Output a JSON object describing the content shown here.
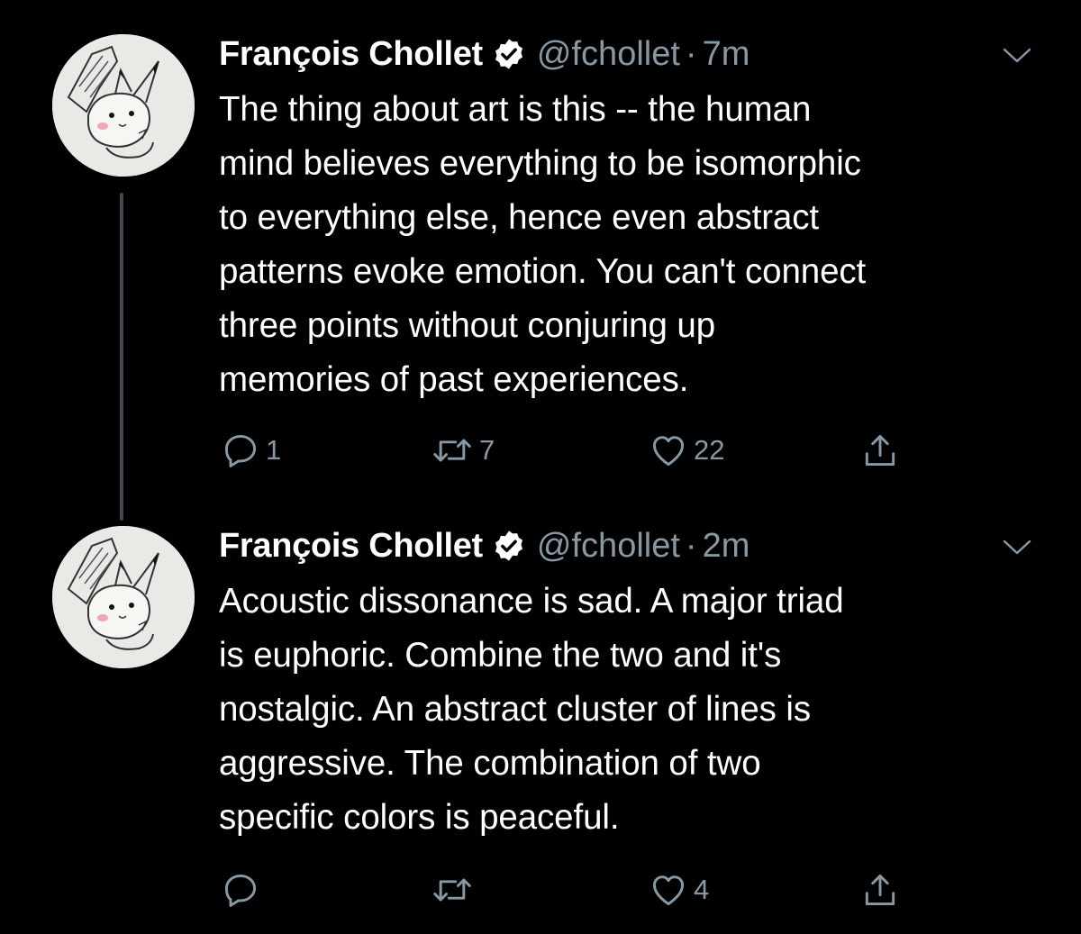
{
  "colors": {
    "background": "#000000",
    "text": "#ffffff",
    "secondary": "#8899a6",
    "thread_line": "#3d4852"
  },
  "tweets": [
    {
      "author_name": "François Chollet",
      "verified_icon": "verified-badge-icon",
      "handle": "@fchollet",
      "separator": "·",
      "time": "7m",
      "lines": [
        "The thing about art is this -- the human",
        "mind believes everything to be isomorphic",
        "to everything else, hence even abstract",
        "patterns evoke emotion. You can't connect",
        "three points without conjuring up",
        "memories of past experiences."
      ],
      "actions": {
        "reply_count": "1",
        "retweet_count": "7",
        "like_count": "22",
        "share_count": ""
      }
    },
    {
      "author_name": "François Chollet",
      "verified_icon": "verified-badge-icon",
      "handle": "@fchollet",
      "separator": "·",
      "time": "2m",
      "lines": [
        "Acoustic dissonance is sad. A major triad",
        "is euphoric. Combine the two and it's",
        "nostalgic. An abstract cluster of lines is",
        "aggressive. The combination of two",
        "specific colors is peaceful."
      ],
      "actions": {
        "reply_count": "",
        "retweet_count": "",
        "like_count": "4",
        "share_count": ""
      }
    }
  ]
}
